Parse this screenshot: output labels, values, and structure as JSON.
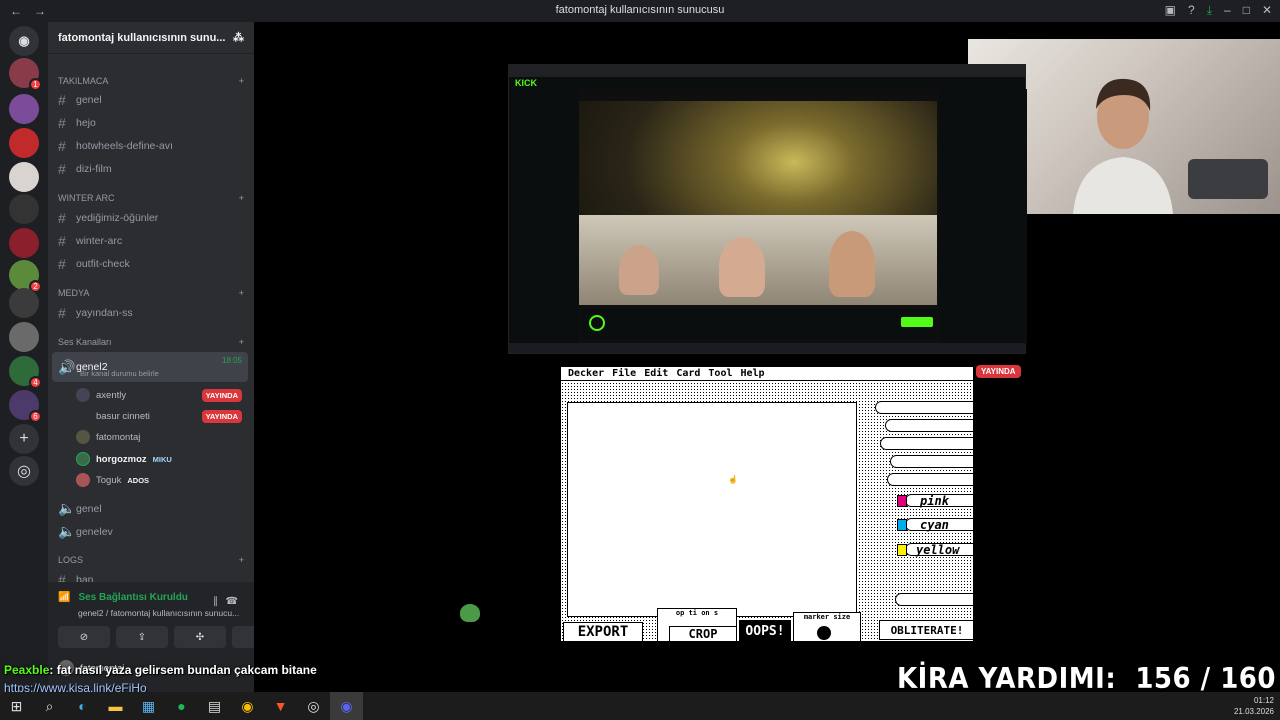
{
  "window": {
    "title": "fatomontaj kullanıcısının sunucusu"
  },
  "server_name": "fatomontaj kullanıcısının sunu...",
  "categories": [
    {
      "name": "TAKILMACA",
      "channels": [
        "genel",
        "hejo",
        "hotwheels-define-avı",
        "dizi-film"
      ]
    },
    {
      "name": "WINTER ARC",
      "channels": [
        "yediğimiz-öğünler",
        "winter-arc",
        "outfit-check"
      ]
    },
    {
      "name": "MEDYA",
      "channels": [
        "yayından-ss"
      ]
    },
    {
      "name": "Ses Kanalları",
      "channels": []
    },
    {
      "name": "LOGS",
      "channels": [
        "ban"
      ]
    }
  ],
  "voice": {
    "active_channel": "genel2",
    "active_time": "18:05",
    "status_hint": "Bir kanal durumu belirle",
    "users": [
      {
        "name": "axently",
        "live": "YAYINDA"
      },
      {
        "name": "basur cinneti",
        "live": "YAYINDA"
      },
      {
        "name": "fatomontaj",
        "live": ""
      },
      {
        "name": "horgozmoz",
        "tag": "MIKU",
        "live": ""
      },
      {
        "name": "Toguk",
        "tag": "ADOS",
        "live": ""
      }
    ],
    "other_channels": [
      "genel",
      "genelev"
    ]
  },
  "connection": {
    "status": "Ses Bağlantısı Kuruldu",
    "sub": "genel2 / fatomontaj kullanıcısının sunucu...",
    "user": "fatomontaj"
  },
  "badges": {
    "s1": "1",
    "s7": "2",
    "s10": "4",
    "s11": "6"
  },
  "stream_badge": "YAYINDA",
  "decker": {
    "menu": [
      "Decker",
      "File",
      "Edit",
      "Card",
      "Tool",
      "Help"
    ],
    "colors": [
      "pink",
      "cyan",
      "yellow"
    ],
    "color_hex": [
      "#e4007c",
      "#00aeef",
      "#fff200"
    ],
    "buttons": {
      "export": "EXPORT",
      "crop": "CROP",
      "oops": "OOPS!",
      "obliterate": "OBLITERATE!",
      "options": "op ti on s",
      "marker": "marker size"
    }
  },
  "overlay": {
    "chat_name": "Peaxble",
    "chat_message": ": fat nasıl yaza gelirsem bundan çakcam bitane",
    "link": "https://www.kisa.link/eFjHo",
    "kira_label": "KİRA YARDIMI:",
    "kira_value": "156 / 160"
  },
  "clock": {
    "time": "01:12",
    "date": "21.03.2026"
  }
}
